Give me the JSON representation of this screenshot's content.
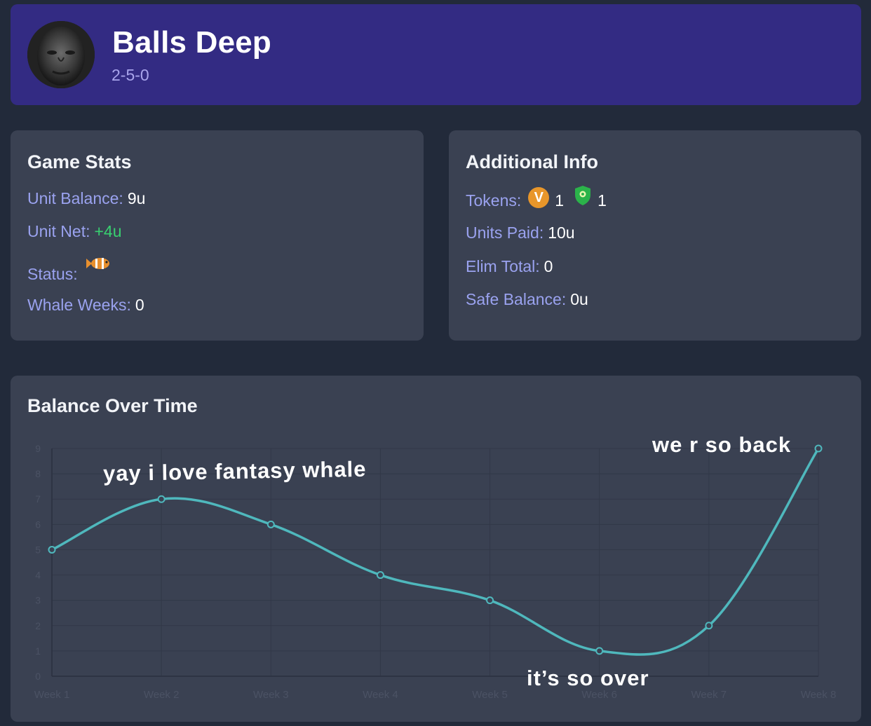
{
  "header": {
    "team_name": "Balls Deep",
    "record": "2-5-0"
  },
  "game_stats": {
    "title": "Game Stats",
    "unit_balance_label": "Unit Balance:",
    "unit_balance_value": "9u",
    "unit_net_label": "Unit Net:",
    "unit_net_value": "+4u",
    "status_label": "Status:",
    "status_icon": "clownfish-icon",
    "whale_weeks_label": "Whale Weeks:",
    "whale_weeks_value": "0"
  },
  "additional_info": {
    "title": "Additional Info",
    "tokens_label": "Tokens:",
    "token_v_letter": "V",
    "token_v_count": "1",
    "token_shield_icon": "shield-icon",
    "token_shield_count": "1",
    "units_paid_label": "Units Paid:",
    "units_paid_value": "10u",
    "elim_total_label": "Elim Total:",
    "elim_total_value": "0",
    "safe_balance_label": "Safe Balance:",
    "safe_balance_value": "0u"
  },
  "balance_chart": {
    "title": "Balance Over Time"
  },
  "annotations": {
    "peak": "yay i love fantasy whale",
    "low": "it’s so over",
    "end": "we r so back"
  },
  "colors": {
    "line": "#4fb8bd",
    "header_bg": "#332b83",
    "card_bg": "#3a4152",
    "page_bg": "#222a3a",
    "label": "#9aa2ef",
    "positive": "#38d070"
  },
  "chart_data": {
    "type": "line",
    "categories": [
      "Week 1",
      "Week 2",
      "Week 3",
      "Week 4",
      "Week 5",
      "Week 6",
      "Week 7",
      "Week 8"
    ],
    "series": [
      {
        "values": [
          5,
          7,
          6,
          4,
          3,
          1,
          2,
          9
        ]
      }
    ],
    "y_ticks": [
      "0",
      "1",
      "2",
      "3",
      "4",
      "5",
      "6",
      "7",
      "8",
      "9"
    ],
    "ylim": [
      0,
      9
    ],
    "grid": true,
    "legend": "none"
  }
}
